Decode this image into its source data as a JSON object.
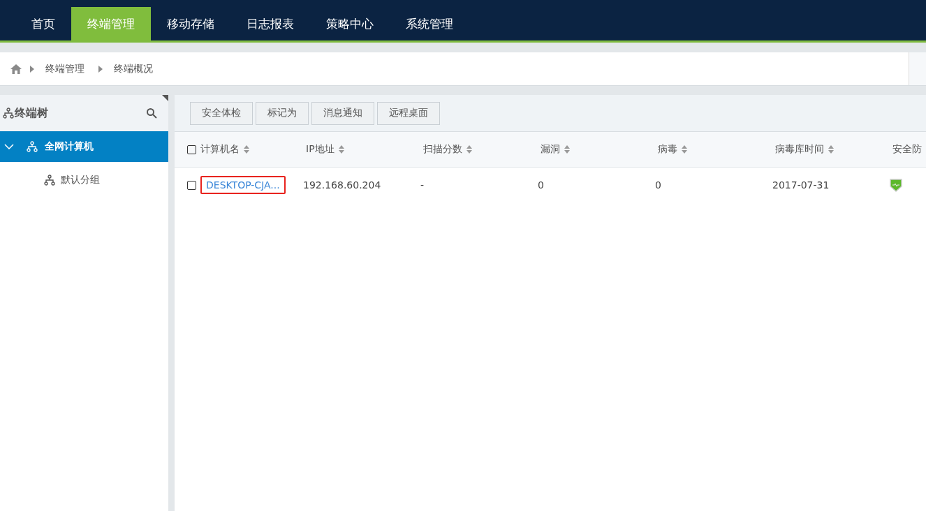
{
  "nav": {
    "tabs": [
      {
        "label": "首页",
        "selected": false
      },
      {
        "label": "终端管理",
        "selected": true
      },
      {
        "label": "移动存储",
        "selected": false
      },
      {
        "label": "日志报表",
        "selected": false
      },
      {
        "label": "策略中心",
        "selected": false
      },
      {
        "label": "系统管理",
        "selected": false
      }
    ]
  },
  "breadcrumb": [
    "终端管理",
    "终端概况"
  ],
  "sidebar": {
    "title": "终端树",
    "tree": [
      {
        "label": "全网计算机",
        "expanded": true,
        "selected": true,
        "children": [
          {
            "label": "默认分组",
            "selected": false
          }
        ]
      }
    ]
  },
  "toolbar": {
    "buttons": [
      "安全体检",
      "标记为",
      "消息通知",
      "远程桌面"
    ]
  },
  "table": {
    "select_all_checked": false,
    "columns": [
      {
        "label": "计算机名",
        "sortable": true
      },
      {
        "label": "IP地址",
        "sortable": true
      },
      {
        "label": "扫描分数",
        "sortable": true
      },
      {
        "label": "漏洞",
        "sortable": true
      },
      {
        "label": "病毒",
        "sortable": true
      },
      {
        "label": "病毒库时间",
        "sortable": true
      },
      {
        "label": "安全防"
      }
    ],
    "rows": [
      {
        "checked": false,
        "name": "DESKTOP-CJA...",
        "name_highlighted": true,
        "ip": "192.168.60.204",
        "scan_score": "-",
        "vulnerabilities": "0",
        "viruses": "0",
        "virus_db_date": "2017-07-31",
        "protected": true
      }
    ]
  }
}
